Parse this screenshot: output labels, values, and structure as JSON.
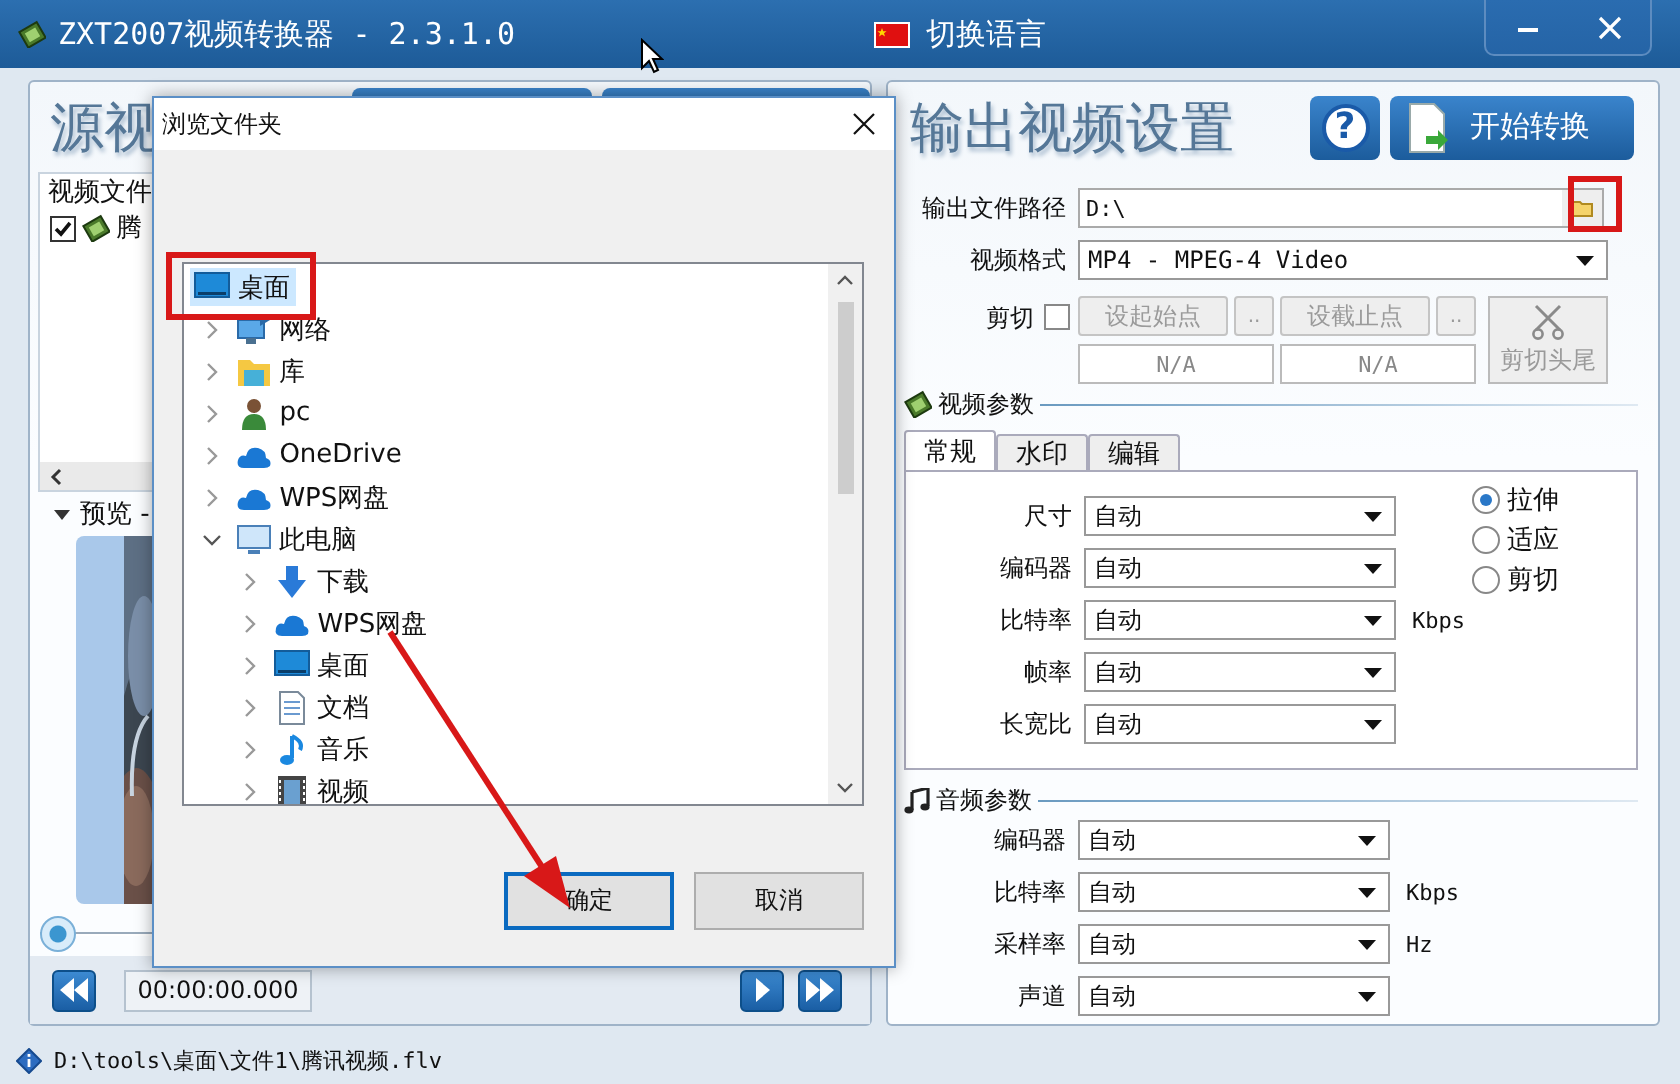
{
  "window": {
    "title": "ZXT2007视频转换器 - 2.3.1.0",
    "language_button": "切换语言"
  },
  "source_panel": {
    "heading": "源视",
    "file_list": {
      "column": "视频文件",
      "rows": [
        {
          "name": "腾",
          "checked": true
        }
      ]
    },
    "preview_label": "预览 -",
    "slider": {
      "level": 0
    },
    "time": "00:00:00.000"
  },
  "output_panel": {
    "heading": "输出视频设置",
    "help_button": "?",
    "start_button": "开始转换",
    "path": {
      "label": "输出文件路径",
      "value": "D:\\"
    },
    "format": {
      "label": "视频格式",
      "value": "MP4 - MPEG-4 Video"
    },
    "cut": {
      "label": "剪切",
      "checked": false,
      "buttons": [
        {
          "label": "设起始点",
          "disabled": true
        },
        {
          "label": "..",
          "disabled": true
        },
        {
          "label": "设截止点",
          "disabled": true
        },
        {
          "label": "..",
          "disabled": true
        }
      ],
      "values": [
        "N/A",
        "N/A"
      ],
      "cut_button": {
        "label": "剪切头尾",
        "disabled": true
      }
    },
    "video_params": {
      "title": "视频参数",
      "tabs": [
        {
          "label": "常规",
          "selected": true
        },
        {
          "label": "水印",
          "selected": false
        },
        {
          "label": "编辑",
          "selected": false
        }
      ],
      "fields": [
        {
          "label": "尺寸",
          "value": "自动"
        },
        {
          "label": "编码器",
          "value": "自动"
        },
        {
          "label": "比特率",
          "value": "自动",
          "unit": "Kbps"
        },
        {
          "label": "帧率",
          "value": "自动"
        },
        {
          "label": "长宽比",
          "value": "自动"
        }
      ],
      "scale_modes": [
        {
          "label": "拉伸",
          "selected": true
        },
        {
          "label": "适应",
          "selected": false
        },
        {
          "label": "剪切",
          "selected": false
        }
      ]
    },
    "audio_params": {
      "title": "音频参数",
      "fields": [
        {
          "label": "编码器",
          "value": "自动"
        },
        {
          "label": "比特率",
          "value": "自动",
          "unit": "Kbps"
        },
        {
          "label": "采样率",
          "value": "自动",
          "unit": "Hz"
        },
        {
          "label": "声道",
          "value": "自动"
        }
      ]
    }
  },
  "dialog": {
    "title": "浏览文件夹",
    "tree": {
      "label": "桌面",
      "kind": "desktop",
      "selected": true,
      "children": [
        {
          "label": "网络",
          "kind": "network",
          "selected": false,
          "expanded": false
        },
        {
          "label": "库",
          "kind": "library",
          "selected": false,
          "expanded": false
        },
        {
          "label": "pc",
          "kind": "user",
          "selected": false,
          "expanded": false
        },
        {
          "label": "OneDrive",
          "kind": "cloud",
          "selected": false,
          "expanded": false
        },
        {
          "label": "WPS网盘",
          "kind": "cloud",
          "selected": false,
          "expanded": false
        },
        {
          "label": "此电脑",
          "kind": "computer",
          "selected": false,
          "expanded": true,
          "children": [
            {
              "label": "下载",
              "kind": "download",
              "selected": false,
              "expanded": false
            },
            {
              "label": "WPS网盘",
              "kind": "cloud",
              "selected": false,
              "expanded": false
            },
            {
              "label": "桌面",
              "kind": "desktop",
              "selected": false,
              "expanded": false
            },
            {
              "label": "文档",
              "kind": "document",
              "selected": false,
              "expanded": false
            },
            {
              "label": "音乐",
              "kind": "music",
              "selected": false,
              "expanded": false
            },
            {
              "label": "视频",
              "kind": "video",
              "selected": false,
              "expanded": false
            }
          ]
        }
      ]
    },
    "buttons": [
      {
        "label": "确定",
        "default": true
      },
      {
        "label": "取消",
        "default": false
      }
    ]
  },
  "annotations": [
    {
      "kind": "frame"
    },
    {
      "kind": "frame"
    },
    {
      "kind": "arrow"
    }
  ],
  "status_bar": {
    "path": "D:\\tools\\桌面\\文件1\\腾讯视频.flv"
  }
}
